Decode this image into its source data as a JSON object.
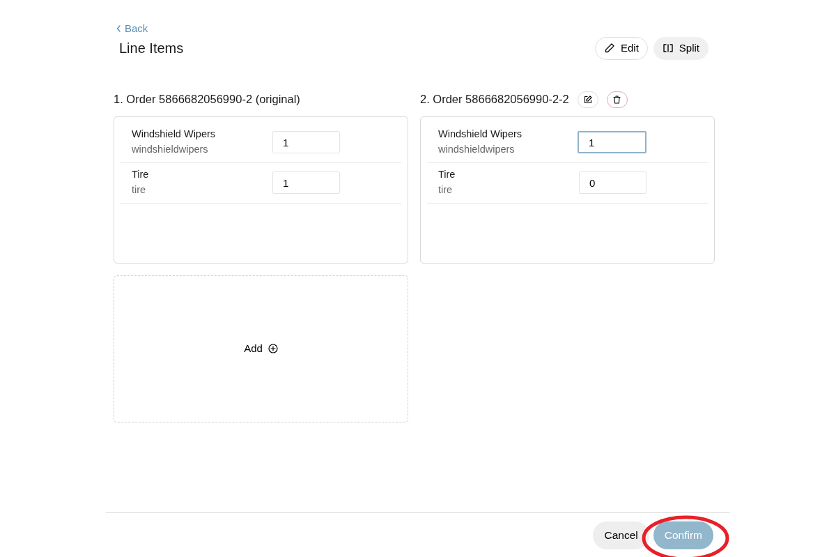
{
  "back_link": "Back",
  "title": "Line Items",
  "header_buttons": [
    {
      "kind": "edit",
      "label": "Edit"
    },
    {
      "kind": "split",
      "label": "Split"
    }
  ],
  "orders": [
    {
      "title": "1. Order 5866682056990-2 (original)",
      "actions": false,
      "items": [
        {
          "name": "Windshield Wipers",
          "sku": "windshieldwipers",
          "quantity": "1",
          "focused": false
        },
        {
          "name": "Tire",
          "sku": "tire",
          "quantity": "1",
          "focused": false
        }
      ]
    },
    {
      "title": "2. Order 5866682056990-2-2",
      "actions": true,
      "items": [
        {
          "name": "Windshield Wipers",
          "sku": "windshieldwipers",
          "quantity": "1",
          "focused": true
        },
        {
          "name": "Tire",
          "sku": "tire",
          "quantity": "0",
          "focused": false
        }
      ]
    }
  ],
  "add_card": {
    "label": "Add"
  },
  "footer": {
    "cancel": "Cancel",
    "confirm": "Confirm",
    "confirm_disabled": true,
    "highlighted": true
  }
}
